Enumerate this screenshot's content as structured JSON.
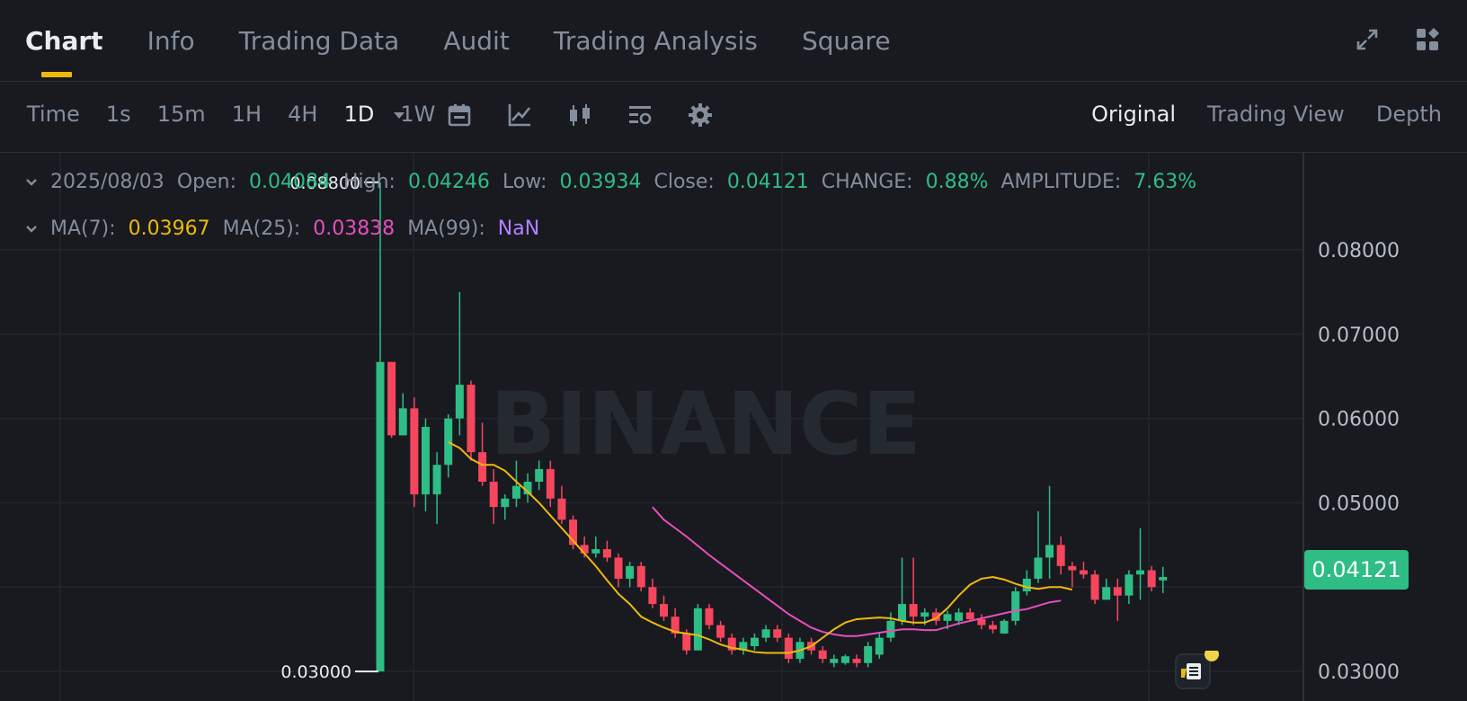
{
  "tabs": [
    {
      "label": "Chart",
      "active": true
    },
    {
      "label": "Info",
      "active": false
    },
    {
      "label": "Trading Data",
      "active": false
    },
    {
      "label": "Audit",
      "active": false
    },
    {
      "label": "Trading Analysis",
      "active": false
    },
    {
      "label": "Square",
      "active": false
    }
  ],
  "top_icons": [
    "expand-icon",
    "layout-grid-icon"
  ],
  "intervals": [
    {
      "label": "Time",
      "active": false
    },
    {
      "label": "1s",
      "active": false
    },
    {
      "label": "15m",
      "active": false
    },
    {
      "label": "1H",
      "active": false
    },
    {
      "label": "4H",
      "active": false
    },
    {
      "label": "1D",
      "active": true
    },
    {
      "label": "1W",
      "active": false
    }
  ],
  "tool_icons": [
    "interval-dropdown-icon",
    "calendar-icon",
    "indicator-icon",
    "candlestick-icon",
    "chart-settings-icon",
    "gear-icon"
  ],
  "views": [
    {
      "label": "Original",
      "active": true
    },
    {
      "label": "Trading View",
      "active": false
    },
    {
      "label": "Depth",
      "active": false
    }
  ],
  "ohlc": {
    "date": "2025/08/03",
    "open_label": "Open:",
    "open": "0.04084",
    "high_label": "High:",
    "high": "0.04246",
    "low_label": "Low:",
    "low": "0.03934",
    "close_label": "Close:",
    "close": "0.04121",
    "change_label": "CHANGE:",
    "change": "0.88%",
    "amplitude_label": "AMPLITUDE:",
    "amplitude": "7.63%"
  },
  "ma": {
    "ma7_label": "MA(7):",
    "ma7": "0.03967",
    "ma25_label": "MA(25):",
    "ma25": "0.03838",
    "ma99_label": "MA(99):",
    "ma99": "NaN"
  },
  "current_price": "0.04121",
  "watermark": "BINANCE",
  "colors": {
    "up": "#2ebd85",
    "down": "#f6465d",
    "ma7": "#f0b90b",
    "ma25": "#e84ebc",
    "ma99": "#b380ff",
    "accent": "#f0b90b"
  },
  "chart_data": {
    "type": "candlestick",
    "y_ticks": [
      "0.08000",
      "0.07000",
      "0.06000",
      "0.05000",
      "0.03000"
    ],
    "ylim": [
      0.0265,
      0.0915
    ],
    "max_label": "0.08800",
    "min_label": "0.03000",
    "candles": [
      [
        0.03,
        0.088,
        0.03,
        0.0667
      ],
      [
        0.0667,
        0.0667,
        0.0577,
        0.058
      ],
      [
        0.058,
        0.063,
        0.058,
        0.0612
      ],
      [
        0.0612,
        0.0625,
        0.0495,
        0.051
      ],
      [
        0.051,
        0.06,
        0.049,
        0.059
      ],
      [
        0.051,
        0.056,
        0.0475,
        0.0545
      ],
      [
        0.0545,
        0.0605,
        0.053,
        0.06
      ],
      [
        0.06,
        0.075,
        0.058,
        0.064
      ],
      [
        0.064,
        0.0645,
        0.055,
        0.056
      ],
      [
        0.056,
        0.0595,
        0.052,
        0.0525
      ],
      [
        0.0525,
        0.054,
        0.0475,
        0.0495
      ],
      [
        0.0495,
        0.051,
        0.048,
        0.0505
      ],
      [
        0.0505,
        0.055,
        0.0495,
        0.052
      ],
      [
        0.051,
        0.0535,
        0.05,
        0.0525
      ],
      [
        0.0525,
        0.055,
        0.0515,
        0.054
      ],
      [
        0.054,
        0.055,
        0.0495,
        0.0505
      ],
      [
        0.0505,
        0.052,
        0.0475,
        0.048
      ],
      [
        0.048,
        0.0485,
        0.0445,
        0.045
      ],
      [
        0.045,
        0.046,
        0.0435,
        0.044
      ],
      [
        0.044,
        0.046,
        0.0435,
        0.0445
      ],
      [
        0.0445,
        0.0455,
        0.043,
        0.0435
      ],
      [
        0.0435,
        0.044,
        0.04,
        0.041
      ],
      [
        0.041,
        0.043,
        0.04,
        0.0425
      ],
      [
        0.0425,
        0.043,
        0.0395,
        0.04
      ],
      [
        0.04,
        0.041,
        0.0375,
        0.038
      ],
      [
        0.038,
        0.039,
        0.036,
        0.0365
      ],
      [
        0.0365,
        0.0375,
        0.034,
        0.0345
      ],
      [
        0.0345,
        0.035,
        0.032,
        0.0325
      ],
      [
        0.0325,
        0.038,
        0.0325,
        0.0375
      ],
      [
        0.0375,
        0.038,
        0.035,
        0.0355
      ],
      [
        0.0355,
        0.036,
        0.0335,
        0.034
      ],
      [
        0.034,
        0.0345,
        0.032,
        0.0325
      ],
      [
        0.0325,
        0.034,
        0.032,
        0.0335
      ],
      [
        0.033,
        0.0345,
        0.0325,
        0.034
      ],
      [
        0.034,
        0.0355,
        0.0335,
        0.035
      ],
      [
        0.035,
        0.0355,
        0.0335,
        0.034
      ],
      [
        0.034,
        0.0345,
        0.031,
        0.0315
      ],
      [
        0.0315,
        0.034,
        0.031,
        0.0335
      ],
      [
        0.0335,
        0.034,
        0.032,
        0.0325
      ],
      [
        0.0325,
        0.033,
        0.031,
        0.0315
      ],
      [
        0.031,
        0.032,
        0.0305,
        0.0315
      ],
      [
        0.031,
        0.032,
        0.0308,
        0.0318
      ],
      [
        0.0315,
        0.032,
        0.0305,
        0.031
      ],
      [
        0.031,
        0.0335,
        0.0305,
        0.033
      ],
      [
        0.032,
        0.0345,
        0.0315,
        0.034
      ],
      [
        0.034,
        0.037,
        0.0335,
        0.036
      ],
      [
        0.036,
        0.0435,
        0.0355,
        0.038
      ],
      [
        0.038,
        0.0435,
        0.0355,
        0.0365
      ],
      [
        0.0365,
        0.0375,
        0.0355,
        0.037
      ],
      [
        0.037,
        0.0375,
        0.0355,
        0.036
      ],
      [
        0.036,
        0.0372,
        0.035,
        0.0368
      ],
      [
        0.036,
        0.0375,
        0.0355,
        0.037
      ],
      [
        0.037,
        0.0375,
        0.036,
        0.0362
      ],
      [
        0.0362,
        0.0368,
        0.035,
        0.0355
      ],
      [
        0.0355,
        0.036,
        0.0345,
        0.035
      ],
      [
        0.0345,
        0.0362,
        0.0345,
        0.036
      ],
      [
        0.036,
        0.04,
        0.0355,
        0.0395
      ],
      [
        0.0395,
        0.042,
        0.039,
        0.041
      ],
      [
        0.041,
        0.049,
        0.0405,
        0.0435
      ],
      [
        0.0435,
        0.052,
        0.041,
        0.045
      ],
      [
        0.045,
        0.046,
        0.0415,
        0.0425
      ],
      [
        0.0425,
        0.043,
        0.04,
        0.042
      ],
      [
        0.042,
        0.043,
        0.041,
        0.0415
      ],
      [
        0.0415,
        0.042,
        0.038,
        0.0385
      ],
      [
        0.0385,
        0.041,
        0.0385,
        0.04
      ],
      [
        0.04,
        0.041,
        0.036,
        0.039
      ],
      [
        0.039,
        0.042,
        0.038,
        0.0415
      ],
      [
        0.0415,
        0.047,
        0.0385,
        0.042
      ],
      [
        0.042,
        0.0425,
        0.0395,
        0.04
      ],
      [
        0.0408,
        0.0424,
        0.0393,
        0.0412
      ]
    ],
    "ma7": [
      0.0572,
      0.0565,
      0.0552,
      0.0545,
      0.0545,
      0.0538,
      0.0525,
      0.0513,
      0.05,
      0.0485,
      0.047,
      0.0455,
      0.044,
      0.0425,
      0.0408,
      0.0392,
      0.038,
      0.0365,
      0.0358,
      0.0352,
      0.0347,
      0.0345,
      0.0343,
      0.0338,
      0.0332,
      0.0328,
      0.0326,
      0.0323,
      0.0322,
      0.0322,
      0.0322,
      0.0325,
      0.033,
      0.034,
      0.035,
      0.0358,
      0.0362,
      0.0363,
      0.0364,
      0.0363,
      0.036,
      0.0358,
      0.0358,
      0.0363,
      0.0375,
      0.039,
      0.0403,
      0.041,
      0.0412,
      0.0409,
      0.0404,
      0.04,
      0.0398,
      0.04,
      0.04,
      0.0397
    ],
    "ma25": [
      0.0495,
      0.048,
      0.047,
      0.046,
      0.0449,
      0.0438,
      0.0428,
      0.0418,
      0.0408,
      0.0398,
      0.0388,
      0.0378,
      0.0368,
      0.036,
      0.0352,
      0.0347,
      0.0344,
      0.0342,
      0.0342,
      0.0344,
      0.0346,
      0.0348,
      0.035,
      0.035,
      0.0349,
      0.0349,
      0.0353,
      0.0357,
      0.036,
      0.0363,
      0.0366,
      0.0369,
      0.0372,
      0.0374,
      0.0378,
      0.0382,
      0.0384
    ]
  }
}
